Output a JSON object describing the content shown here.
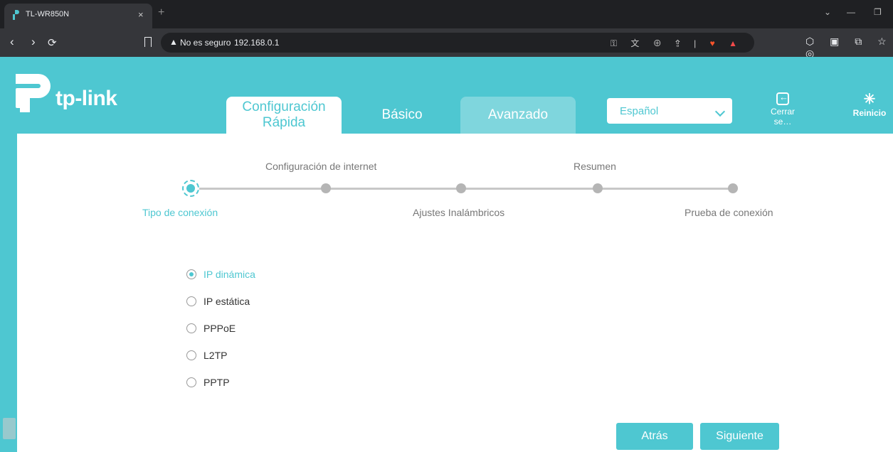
{
  "browser": {
    "tab_title": "TL-WR850N",
    "tab_close": "×",
    "new_tab": "+",
    "minimize": "—",
    "restore": "❐",
    "tab_list": "⌄",
    "back": "‹",
    "forward": "›",
    "reload": "⟳",
    "security_label": "No es seguro",
    "url": "192.168.0.1",
    "warn_glyph": "▲",
    "url_icons": "⚿ 文 ⊕ ⇪ |",
    "shield_glyph": "♥",
    "rewards_glyph": "▲",
    "extension_icons": "⬡ ▣ ⧉ ☆ ◎"
  },
  "header": {
    "logo_text": "tp-link",
    "tabs": [
      {
        "line1": "Configuración",
        "line2": "Rápida"
      },
      {
        "line1": "Básico"
      },
      {
        "line1": "Avanzado"
      }
    ],
    "language": "Español",
    "logout_label": "Cerrar se…",
    "reboot_label": "Reinicio",
    "reboot_glyph": "✳"
  },
  "wizard": {
    "steps_top": [
      "Configuración de internet",
      "Resumen"
    ],
    "steps_bottom": [
      "Tipo de conexión",
      "Ajustes Inalámbricos",
      "Prueba de conexión"
    ],
    "active_step": 0
  },
  "connection_types": [
    {
      "label": "IP dinámica",
      "checked": true
    },
    {
      "label": "IP estática",
      "checked": false
    },
    {
      "label": "PPPoE",
      "checked": false
    },
    {
      "label": "L2TP",
      "checked": false
    },
    {
      "label": "PPTP",
      "checked": false
    }
  ],
  "buttons": {
    "back": "Atrás",
    "next": "Siguiente"
  },
  "colors": {
    "brand": "#4ec7d1",
    "tab_hover": "#7fd6dd",
    "chrome_dark": "#1f2023"
  }
}
